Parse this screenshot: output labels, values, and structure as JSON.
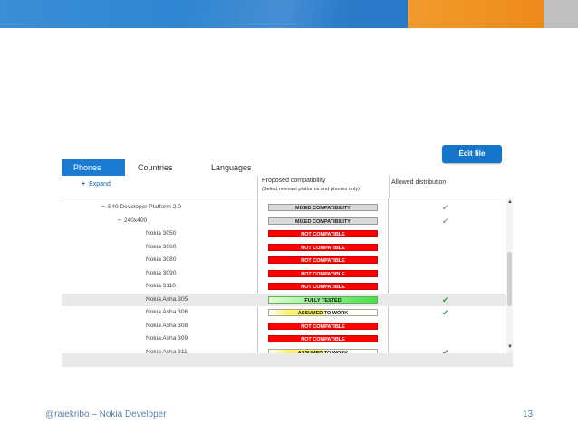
{
  "colors": {
    "banner_blue": "#2f86d2",
    "banner_orange": "#ee8a1c",
    "tab_blue": "#1a7bd0",
    "not_compatible": "#ff0000",
    "fully_tested": "#46e046",
    "assumed": "#fff36a"
  },
  "toolbar": {
    "edit_file_label": "Edit file"
  },
  "tabs": [
    {
      "label": "Phones",
      "active": true
    },
    {
      "label": "Countries",
      "active": false
    },
    {
      "label": "Languages",
      "active": false
    }
  ],
  "tree": {
    "expand_label": "Expand"
  },
  "columns": {
    "proposed": "Proposed compatibility",
    "proposed_hint": "(Select relevant platforms and phones only)",
    "allowed": "Allowed distribution"
  },
  "rows": [
    {
      "name": "S40 Developer Platform 2.0",
      "status": "MIXED COMPATIBILITY",
      "kind": "mixed",
      "check": "grey-check-icon",
      "indent": 1,
      "selected": false
    },
    {
      "name": "240x400",
      "status": "MIXED COMPATIBILITY",
      "kind": "mixed",
      "check": "grey-check-icon",
      "indent": 2,
      "selected": false
    },
    {
      "name": "Nokia 3050",
      "status": "NOT COMPATIBLE",
      "kind": "notc",
      "check": "",
      "indent": 3,
      "selected": false
    },
    {
      "name": "Nokia 3060",
      "status": "NOT COMPATIBLE",
      "kind": "notc",
      "check": "",
      "indent": 3,
      "selected": false
    },
    {
      "name": "Nokia 3080",
      "status": "NOT COMPATIBLE",
      "kind": "notc",
      "check": "",
      "indent": 3,
      "selected": false
    },
    {
      "name": "Nokia 3090",
      "status": "NOT COMPATIBLE",
      "kind": "notc",
      "check": "",
      "indent": 3,
      "selected": false
    },
    {
      "name": "Nokia 3110",
      "status": "NOT COMPATIBLE",
      "kind": "notc",
      "check": "",
      "indent": 3,
      "selected": false
    },
    {
      "name": "Nokia Asha 305",
      "status": "FULLY TESTED",
      "kind": "full",
      "check": "green-check-icon",
      "indent": 3,
      "selected": true
    },
    {
      "name": "Nokia Asha 306",
      "status": "ASSUMED TO WORK",
      "kind": "assumed",
      "check": "green-check-icon",
      "indent": 3,
      "selected": false
    },
    {
      "name": "Nokia Asha 308",
      "status": "NOT COMPATIBLE",
      "kind": "notc",
      "check": "",
      "indent": 3,
      "selected": false
    },
    {
      "name": "Nokia Asha 309",
      "status": "NOT COMPATIBLE",
      "kind": "notc",
      "check": "",
      "indent": 3,
      "selected": false
    },
    {
      "name": "Nokia Asha 311",
      "status": "ASSUMED TO WORK",
      "kind": "assumed",
      "check": "green-check-icon",
      "indent": 3,
      "selected": false
    }
  ],
  "footer": {
    "left": "@raiekribo – Nokia Developer",
    "page_number": "13"
  }
}
